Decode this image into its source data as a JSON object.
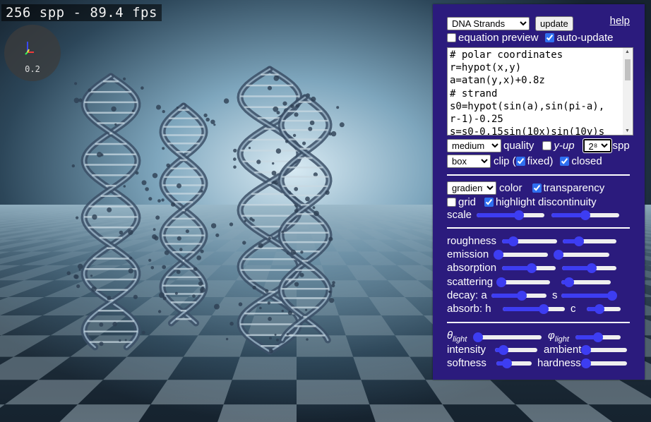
{
  "viewport": {
    "fps_text": "256 spp - 89.4 fps",
    "axis_scale": "0.2"
  },
  "panel": {
    "preset": {
      "selected": "DNA Strands"
    },
    "update_label": "update",
    "help_label": "help",
    "equation_preview": {
      "label": "equation preview",
      "checked": false
    },
    "auto_update": {
      "label": "auto-update",
      "checked": true
    },
    "code_text": "# polar coordinates\nr=hypot(x,y)\na=atan(y,x)+0.8z\n# strand\ns0=hypot(sin(a),sin(pi-a),\nr-1)-0.25\ns=s0-0.15sin(10x)sin(10y)s",
    "quality": {
      "selected": "medium",
      "label": "quality"
    },
    "y_up": {
      "label": "y-up",
      "checked": false
    },
    "spp": {
      "selected": "2⁸",
      "label": "spp"
    },
    "clip": {
      "selected": "box",
      "label": "clip ("
    },
    "fixed": {
      "label": "fixed)",
      "checked": true
    },
    "closed": {
      "label": "closed",
      "checked": true
    },
    "color": {
      "selected": "gradient",
      "label": "color"
    },
    "transparency": {
      "label": "transparency",
      "checked": true
    },
    "grid": {
      "label": "grid",
      "checked": false
    },
    "highlight_discontinuity": {
      "label": "highlight discontinuity",
      "checked": true
    },
    "scale": {
      "label": "scale",
      "values": [
        0.62,
        0.5
      ]
    },
    "roughness": {
      "label": "roughness",
      "values": [
        0.2,
        0.3
      ]
    },
    "emission": {
      "label": "emission",
      "values": [
        0.0,
        0.0
      ]
    },
    "absorption": {
      "label": "absorption",
      "values": [
        0.55,
        0.55
      ]
    },
    "scattering": {
      "label": "scattering",
      "values": [
        0.05,
        0.15
      ]
    },
    "decay": {
      "label_a": "decay: a",
      "label_b": "s",
      "values": [
        0.55,
        1.0
      ]
    },
    "absorb": {
      "label_h": "absorb: h",
      "label_c": "c",
      "values": [
        0.66,
        0.38
      ]
    },
    "theta_light": {
      "label_base": "θ",
      "label_sub": "light",
      "value": 0.0
    },
    "phi_light": {
      "label_base": "φ",
      "label_sub": "light",
      "value": 0.5
    },
    "intensity": {
      "label": "intensity",
      "value": 0.2
    },
    "ambient": {
      "label": "ambient",
      "value": 0.0
    },
    "softness": {
      "label": "softness",
      "value": 0.3
    },
    "hardness": {
      "label": "hardness",
      "value": 0.0
    }
  },
  "colors": {
    "panel_bg": "#2b1b7d",
    "slider_accent": "#3d3df2",
    "checkbox_accent": "#2f6ff0"
  }
}
